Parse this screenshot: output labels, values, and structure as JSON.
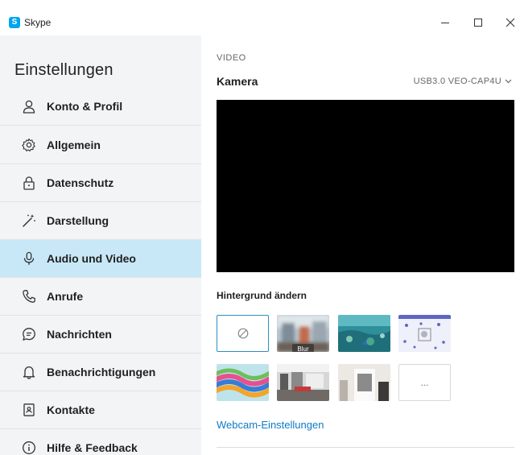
{
  "window": {
    "title": "Skype",
    "logo_letter": "S",
    "minimize_label": "",
    "close_label": ""
  },
  "sidebar": {
    "title": "Einstellungen",
    "items": [
      {
        "label": "Konto & Profil",
        "icon": "person-icon"
      },
      {
        "label": "Allgemein",
        "icon": "gear-icon"
      },
      {
        "label": "Datenschutz",
        "icon": "lock-icon"
      },
      {
        "label": "Darstellung",
        "icon": "magic-wand-icon"
      },
      {
        "label": "Audio und Video",
        "icon": "microphone-icon",
        "active": true
      },
      {
        "label": "Anrufe",
        "icon": "phone-icon"
      },
      {
        "label": "Nachrichten",
        "icon": "chat-bubble-icon"
      },
      {
        "label": "Benachrichtigungen",
        "icon": "bell-icon"
      },
      {
        "label": "Kontakte",
        "icon": "contacts-book-icon"
      },
      {
        "label": "Hilfe & Feedback",
        "icon": "info-icon"
      }
    ]
  },
  "main": {
    "section_label": "VIDEO",
    "camera_label": "Kamera",
    "camera_device": "USB3.0 VEO-CAP4U",
    "background_label": "Hintergrund ändern",
    "backgrounds": [
      {
        "name": "none",
        "label": ""
      },
      {
        "name": "blur",
        "label": "Blur"
      },
      {
        "name": "underwater",
        "label": ""
      },
      {
        "name": "snowflakes",
        "label": ""
      },
      {
        "name": "colorful-waves",
        "label": ""
      },
      {
        "name": "office",
        "label": ""
      },
      {
        "name": "room",
        "label": ""
      },
      {
        "name": "more",
        "label": "..."
      }
    ],
    "webcam_link": "Webcam-Einstellungen"
  },
  "colors": {
    "accent": "#0d7bc7",
    "active_nav": "#c9e8f7",
    "sidebar_bg": "#f3f4f6",
    "skype_blue": "#00a4ef"
  }
}
